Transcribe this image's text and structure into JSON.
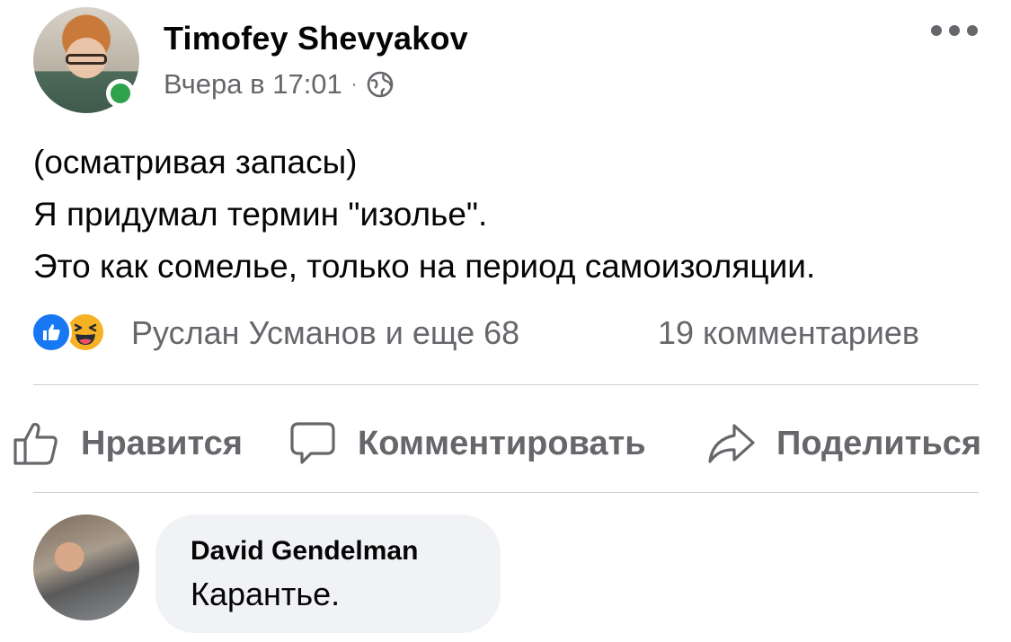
{
  "post": {
    "author": "Timofey Shevyakov",
    "timestamp": "Вчера в 17:01",
    "separator": "·",
    "privacy_icon": "globe-icon",
    "lines": [
      "(осматривая запасы)",
      "Я придумал термин \"изолье\".",
      "Это как сомелье, только на период самоизоляции."
    ]
  },
  "reactions": {
    "icons": [
      "like-icon",
      "haha-icon"
    ],
    "summary": "Руслан Усманов и еще 68",
    "comments": "19 комментариев"
  },
  "actions": {
    "like": "Нравится",
    "comment": "Комментировать",
    "share": "Поделиться"
  },
  "comment": {
    "author": "David Gendelman",
    "text": "Карантье."
  },
  "colors": {
    "online": "#31a24c",
    "like_blue": "#1877f2",
    "haha_yellow": "#f7b125",
    "secondary_text": "#65676b",
    "bubble": "#f0f2f5"
  }
}
